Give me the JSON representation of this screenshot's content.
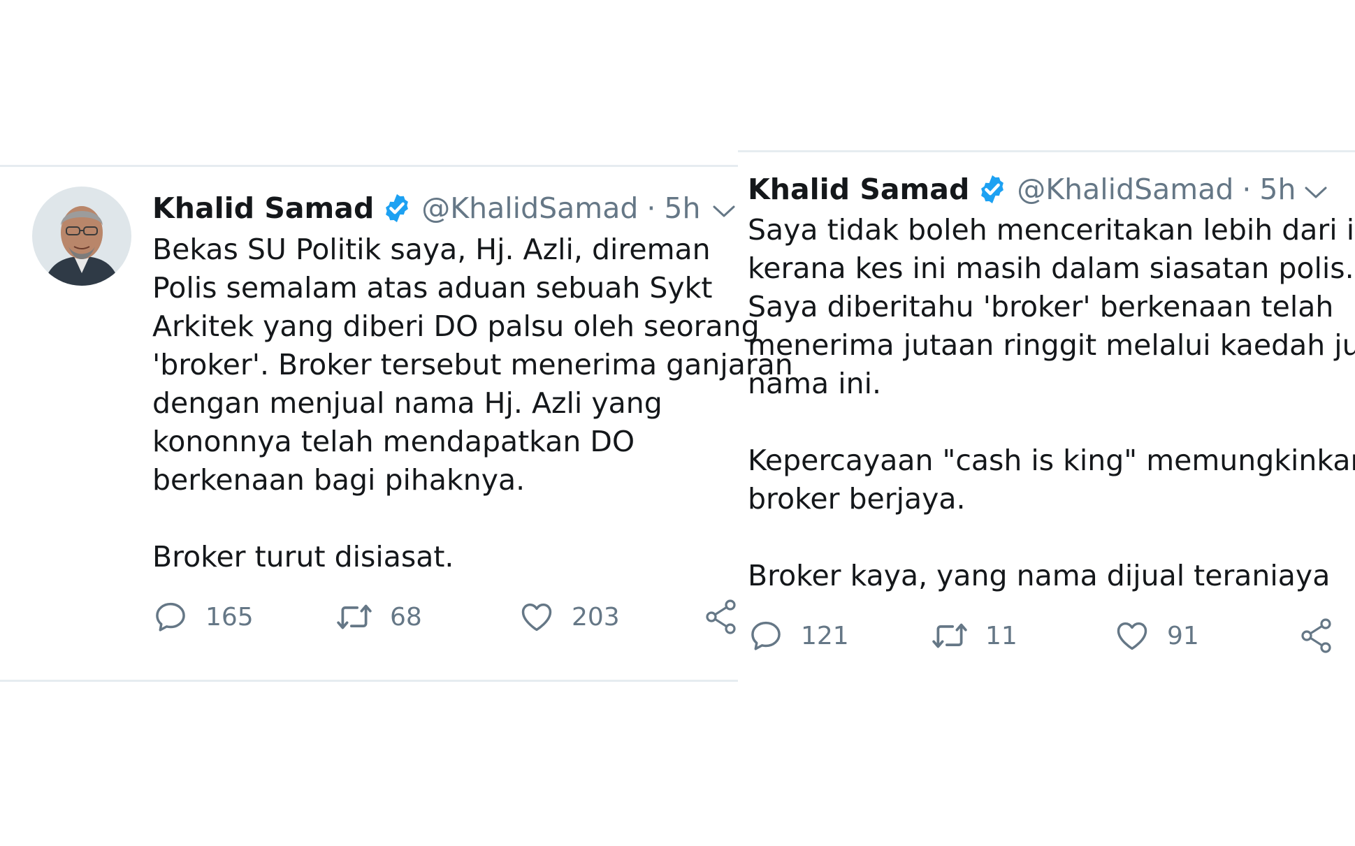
{
  "tweets": [
    {
      "name": "Khalid Samad",
      "handle": "@KhalidSamad",
      "separator": "·",
      "time": "5h",
      "paragraphs": [
        [
          "Bekas SU Politik saya, Hj. Azli, direman",
          "Polis semalam atas aduan sebuah Sykt",
          "Arkitek yang diberi DO palsu oleh seorang",
          "'broker'. Broker tersebut menerima ganjaran",
          "dengan menjual nama Hj. Azli yang",
          "kononnya telah mendapatkan DO",
          "berkenaan bagi pihaknya."
        ],
        [
          "Broker turut disiasat."
        ]
      ],
      "stats": {
        "replies": "165",
        "retweets": "68",
        "likes": "203"
      }
    },
    {
      "name": "Khalid Samad",
      "handle": "@KhalidSamad",
      "separator": "·",
      "time": "5h",
      "paragraphs": [
        [
          "Saya tidak boleh menceritakan lebih dari itu",
          "kerana kes ini masih dalam siasatan polis.",
          "Saya diberitahu 'broker' berkenaan telah",
          "menerima jutaan ringgit melalui kaedah jual",
          "nama ini."
        ],
        [
          "Kepercayaan \"cash is king\" memungkinkan",
          "broker berjaya."
        ],
        [
          "Broker kaya, yang nama dijual teraniaya"
        ]
      ],
      "stats": {
        "replies": "121",
        "retweets": "11",
        "likes": "91"
      }
    }
  ],
  "colors": {
    "text": "#14171a",
    "muted": "#657786",
    "verified": "#1da1f2",
    "divider": "#e6ecf0"
  },
  "icons": [
    "verified-badge-icon",
    "chevron-down-icon",
    "reply-icon",
    "retweet-icon",
    "like-icon",
    "share-icon"
  ]
}
